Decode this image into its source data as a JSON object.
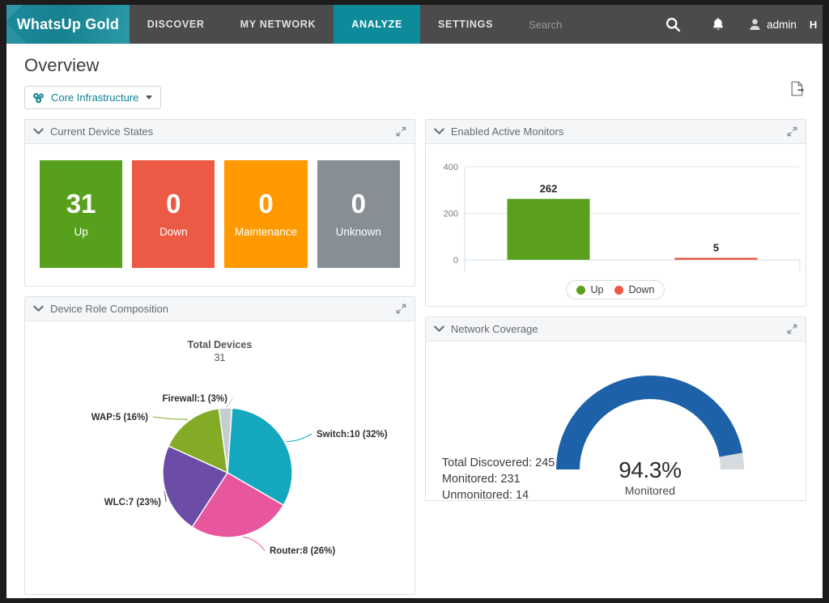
{
  "nav": {
    "logo": "WhatsUp Gold",
    "items": [
      {
        "label": "DISCOVER",
        "active": false
      },
      {
        "label": "MY NETWORK",
        "active": false
      },
      {
        "label": "ANALYZE",
        "active": true
      },
      {
        "label": "SETTINGS",
        "active": false
      }
    ],
    "search_placeholder": "Search",
    "search_value": "",
    "user": "admin",
    "help": "H",
    "active_color": "#0d8b9b",
    "bar_color": "#4b4b4b"
  },
  "page": {
    "title": "Overview",
    "scope": "Core Infrastructure"
  },
  "cards": {
    "device_states": {
      "title": "Current Device States"
    },
    "active_monitors": {
      "title": "Enabled Active Monitors"
    },
    "role_composition": {
      "title": "Device Role Composition"
    },
    "network_coverage": {
      "title": "Network Coverage"
    }
  },
  "device_states": {
    "tiles": [
      {
        "value": "31",
        "label": "Up",
        "color": "#57a01c"
      },
      {
        "value": "0",
        "label": "Down",
        "color": "#ec5a45"
      },
      {
        "value": "0",
        "label": "Maintenance",
        "color": "#ff9900"
      },
      {
        "value": "0",
        "label": "Unknown",
        "color": "#878f95"
      }
    ]
  },
  "network_coverage": {
    "percent_label": "94.3%",
    "percent_sub": "Monitored",
    "percent_value": 94.3,
    "total_discovered_label": "Total Discovered: 245",
    "monitored_label": "Monitored: 231",
    "unmonitored_label": "Unmonitored: 14",
    "arc_color": "#1d62a8",
    "track_color": "#d5dade"
  },
  "chart_data": [
    {
      "id": "active_monitors",
      "type": "bar",
      "title": "Enabled Active Monitors",
      "categories": [
        "Up",
        "Down"
      ],
      "values": [
        262,
        5
      ],
      "data_labels": [
        "262",
        "5"
      ],
      "colors": [
        "#5aa01e",
        "#ec5a45"
      ],
      "xlabel": "",
      "ylabel": "",
      "ylim": [
        0,
        400
      ],
      "yticks": [
        0,
        200,
        400
      ],
      "ytick_labels": [
        "0",
        "200",
        "400"
      ],
      "grid": true,
      "legend": {
        "position": "bottom",
        "entries": [
          "Up",
          "Down"
        ]
      }
    },
    {
      "id": "role_composition",
      "type": "pie",
      "title": "Device Role Composition",
      "center_label": "Total Devices",
      "center_value": "31",
      "total": 31,
      "categories": [
        "Switch",
        "Router",
        "WLC",
        "WAP",
        "Firewall"
      ],
      "values": [
        10,
        8,
        7,
        5,
        1
      ],
      "percents": [
        32,
        26,
        23,
        16,
        3
      ],
      "labels": [
        "Switch:10 (32%)",
        "Router:8 (26%)",
        "WLC:7 (23%)",
        "WAP:5 (16%)",
        "Firewall:1 (3%)"
      ],
      "colors": [
        "#13a8bd",
        "#e8569e",
        "#6b4ca6",
        "#83ab25",
        "#c4cdd0"
      ]
    },
    {
      "id": "network_coverage",
      "type": "gauge",
      "title": "Network Coverage",
      "value": 94.3,
      "min": 0,
      "max": 100,
      "value_label": "94.3%",
      "sub_label": "Monitored",
      "annotations": [
        "Total Discovered: 245",
        "Monitored: 231",
        "Unmonitored: 14"
      ],
      "colors": [
        "#1d62a8",
        "#d5dade"
      ]
    }
  ],
  "icons": {
    "search": "search-icon",
    "bell": "bell-icon",
    "user": "user-icon",
    "export": "export-icon",
    "collapse": "chevron-down-icon",
    "expand": "expand-icon",
    "scope": "device-group-icon"
  }
}
